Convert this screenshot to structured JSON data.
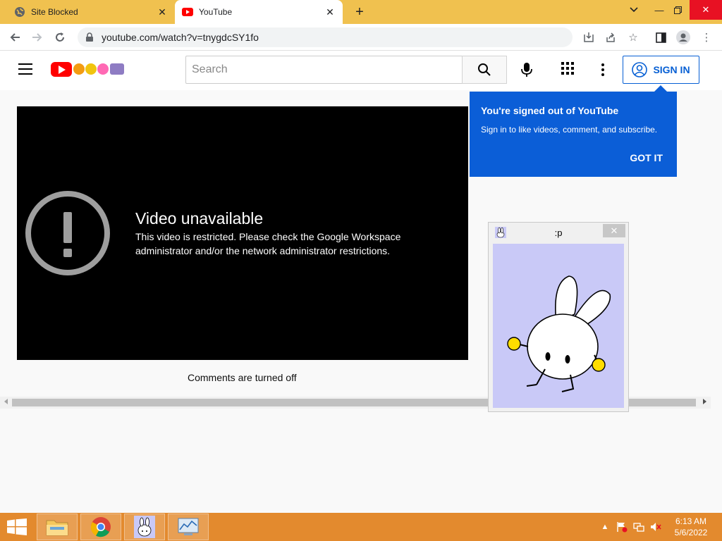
{
  "browser": {
    "tabs": [
      {
        "label": "Site Blocked",
        "active": false
      },
      {
        "label": "YouTube",
        "active": true
      }
    ],
    "url": "youtube.com/watch?v=tnygdcSY1fo"
  },
  "youtube": {
    "search_placeholder": "Search",
    "sign_in_label": "SIGN IN",
    "error_title": "Video unavailable",
    "error_message": "This video is restricted. Please check the Google Workspace administrator and/or the network administrator restrictions.",
    "comments_text": "Comments are turned off",
    "brand_color": "#ff0000",
    "accent_color": "#065fd4"
  },
  "popup": {
    "title": "You're signed out of YouTube",
    "message": "Sign in to like videos, comment, and subscribe.",
    "button": "GOT IT"
  },
  "mini_window": {
    "title": ":p"
  },
  "taskbar": {
    "time": "6:13 AM",
    "date": "5/6/2022"
  }
}
